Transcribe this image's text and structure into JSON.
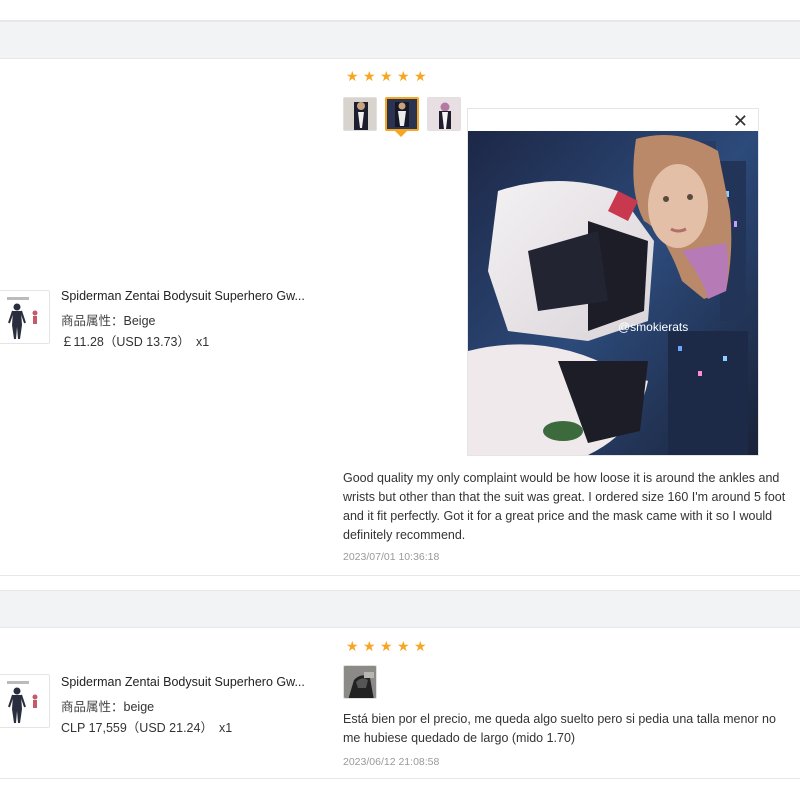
{
  "reviews": [
    {
      "product_name": "Spiderman Zentai Bodysuit Superhero Gw...",
      "attr_label": "商品属性：",
      "attr_value": "Beige",
      "price": "￡11.28（USD  13.73）",
      "quantity": "x1",
      "rating": 5,
      "photo_count": 3,
      "active_photo": 2,
      "watermark": "@smokierats",
      "text": "Good quality my only complaint would be how loose it is around the ankles and wrists but other than that the suit was great. I ordered size 160 I'm around 5 foot and it fit perfectly. Got it for a great price and the mask came with it so I would definitely recommend.",
      "date": "2023/07/01 10:36:18"
    },
    {
      "product_name": "Spiderman Zentai Bodysuit Superhero Gw...",
      "attr_label": "商品属性：",
      "attr_value": "beige",
      "price": "CLP 17,559（USD  21.24）",
      "quantity": "x1",
      "rating": 5,
      "photo_count": 1,
      "text": "Está bien por el precio, me queda algo suelto pero si pedia una talla menor no me hubiese quedado de largo (mido 1.70)",
      "date": "2023/06/12 21:08:58"
    }
  ],
  "icons": {
    "star": "star-icon",
    "close": "close-icon"
  },
  "colors": {
    "star": "#f6a623",
    "active_thumb_border": "#f5a623",
    "band": "#f2f3f5",
    "date": "#999999"
  }
}
